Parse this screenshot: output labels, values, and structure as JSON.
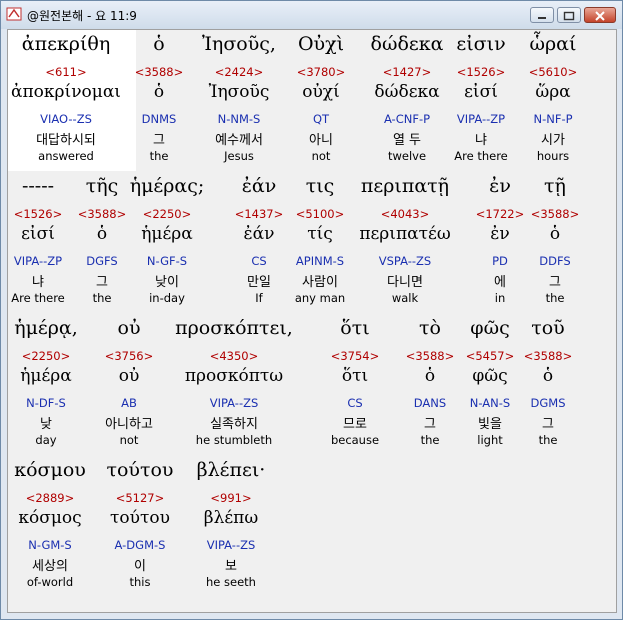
{
  "window": {
    "title": "@원전본해 - 요 11:9"
  },
  "rows": [
    {
      "words": [
        {
          "greek": "ἀπεκρίθη",
          "strong": "<611>",
          "lemma": "ἀποκρίνομαι",
          "parse": "VIAO--ZS",
          "korean": "대답하시되",
          "english": "answered"
        },
        {
          "greek": "ὁ",
          "strong": "<3588>",
          "lemma": "ὁ",
          "parse": "DNMS",
          "korean": "그",
          "english": "the"
        },
        {
          "greek": "Ἰησοῦς,",
          "strong": "<2424>",
          "lemma": "Ἰησοῦς",
          "parse": "N-NM-S",
          "korean": "예수께서",
          "english": "Jesus"
        },
        {
          "greek": "Οὐχὶ",
          "strong": "<3780>",
          "lemma": "οὐχί",
          "parse": "QT",
          "korean": "아니",
          "english": "not"
        },
        {
          "greek": "δώδεκα",
          "strong": "<1427>",
          "lemma": "δώδεκα",
          "parse": "A-CNF-P",
          "korean": "열 두",
          "english": "twelve"
        },
        {
          "greek": "εἰσιν",
          "strong": "<1526>",
          "lemma": "εἰσί",
          "parse": "VIPA--ZP",
          "korean": "냐",
          "english": "Are there"
        },
        {
          "greek": "ὧραί",
          "strong": "<5610>",
          "lemma": "ὥρα",
          "parse": "N-NF-P",
          "korean": "시가",
          "english": "hours"
        }
      ]
    },
    {
      "words": [
        {
          "greek": "-----",
          "strong": "<1526>",
          "lemma": "εἰσί",
          "parse": "VIPA--ZP",
          "korean": "냐",
          "english": "Are there"
        },
        {
          "greek": "τῆς",
          "strong": "<3588>",
          "lemma": "ὁ",
          "parse": "DGFS",
          "korean": "그",
          "english": "the"
        },
        {
          "greek": "ἡμέρας;",
          "strong": "<2250>",
          "lemma": "ἡμέρα",
          "parse": "N-GF-S",
          "korean": "낮이",
          "english": "in-day"
        },
        {
          "greek": "ἐάν",
          "strong": "<1437>",
          "lemma": "ἐάν",
          "parse": "CS",
          "korean": "만일",
          "english": "If"
        },
        {
          "greek": "τις",
          "strong": "<5100>",
          "lemma": "τίς",
          "parse": "APINM-S",
          "korean": "사람이",
          "english": "any man"
        },
        {
          "greek": "περιπατῇ",
          "strong": "<4043>",
          "lemma": "περιπατέω",
          "parse": "VSPA--ZS",
          "korean": "다니면",
          "english": "walk"
        },
        {
          "greek": "ἐν",
          "strong": "<1722>",
          "lemma": "ἐν",
          "parse": "PD",
          "korean": "에",
          "english": "in"
        },
        {
          "greek": "τῇ",
          "strong": "<3588>",
          "lemma": "ὁ",
          "parse": "DDFS",
          "korean": "그",
          "english": "the"
        }
      ]
    },
    {
      "words": [
        {
          "greek": "ἡμέρᾳ,",
          "strong": "<2250>",
          "lemma": "ἡμέρα",
          "parse": "N-DF-S",
          "korean": "낮",
          "english": "day"
        },
        {
          "greek": "οὐ",
          "strong": "<3756>",
          "lemma": "οὐ",
          "parse": "AB",
          "korean": "아니하고",
          "english": "not"
        },
        {
          "greek": "προσκόπτει,",
          "strong": "<4350>",
          "lemma": "προσκόπτω",
          "parse": "VIPA--ZS",
          "korean": "실족하지",
          "english": "he stumbleth"
        },
        {
          "greek": "ὅτι",
          "strong": "<3754>",
          "lemma": "ὅτι",
          "parse": "CS",
          "korean": "므로",
          "english": "because"
        },
        {
          "greek": "τὸ",
          "strong": "<3588>",
          "lemma": "ὁ",
          "parse": "DANS",
          "korean": "그",
          "english": "the"
        },
        {
          "greek": "φῶς",
          "strong": "<5457>",
          "lemma": "φῶς",
          "parse": "N-AN-S",
          "korean": "빛을",
          "english": "light"
        },
        {
          "greek": "τοῦ",
          "strong": "<3588>",
          "lemma": "ὁ",
          "parse": "DGMS",
          "korean": "그",
          "english": "the"
        }
      ]
    },
    {
      "words": [
        {
          "greek": "κόσμου",
          "strong": "<2889>",
          "lemma": "κόσμος",
          "parse": "N-GM-S",
          "korean": "세상의",
          "english": "of-world"
        },
        {
          "greek": "τούτου",
          "strong": "<5127>",
          "lemma": "τούτου",
          "parse": "A-DGM-S",
          "korean": "이",
          "english": "this"
        },
        {
          "greek": "βλέπει·",
          "strong": "<991>",
          "lemma": "βλέπω",
          "parse": "VIPA--ZS",
          "korean": "보",
          "english": "he seeth"
        }
      ]
    }
  ]
}
